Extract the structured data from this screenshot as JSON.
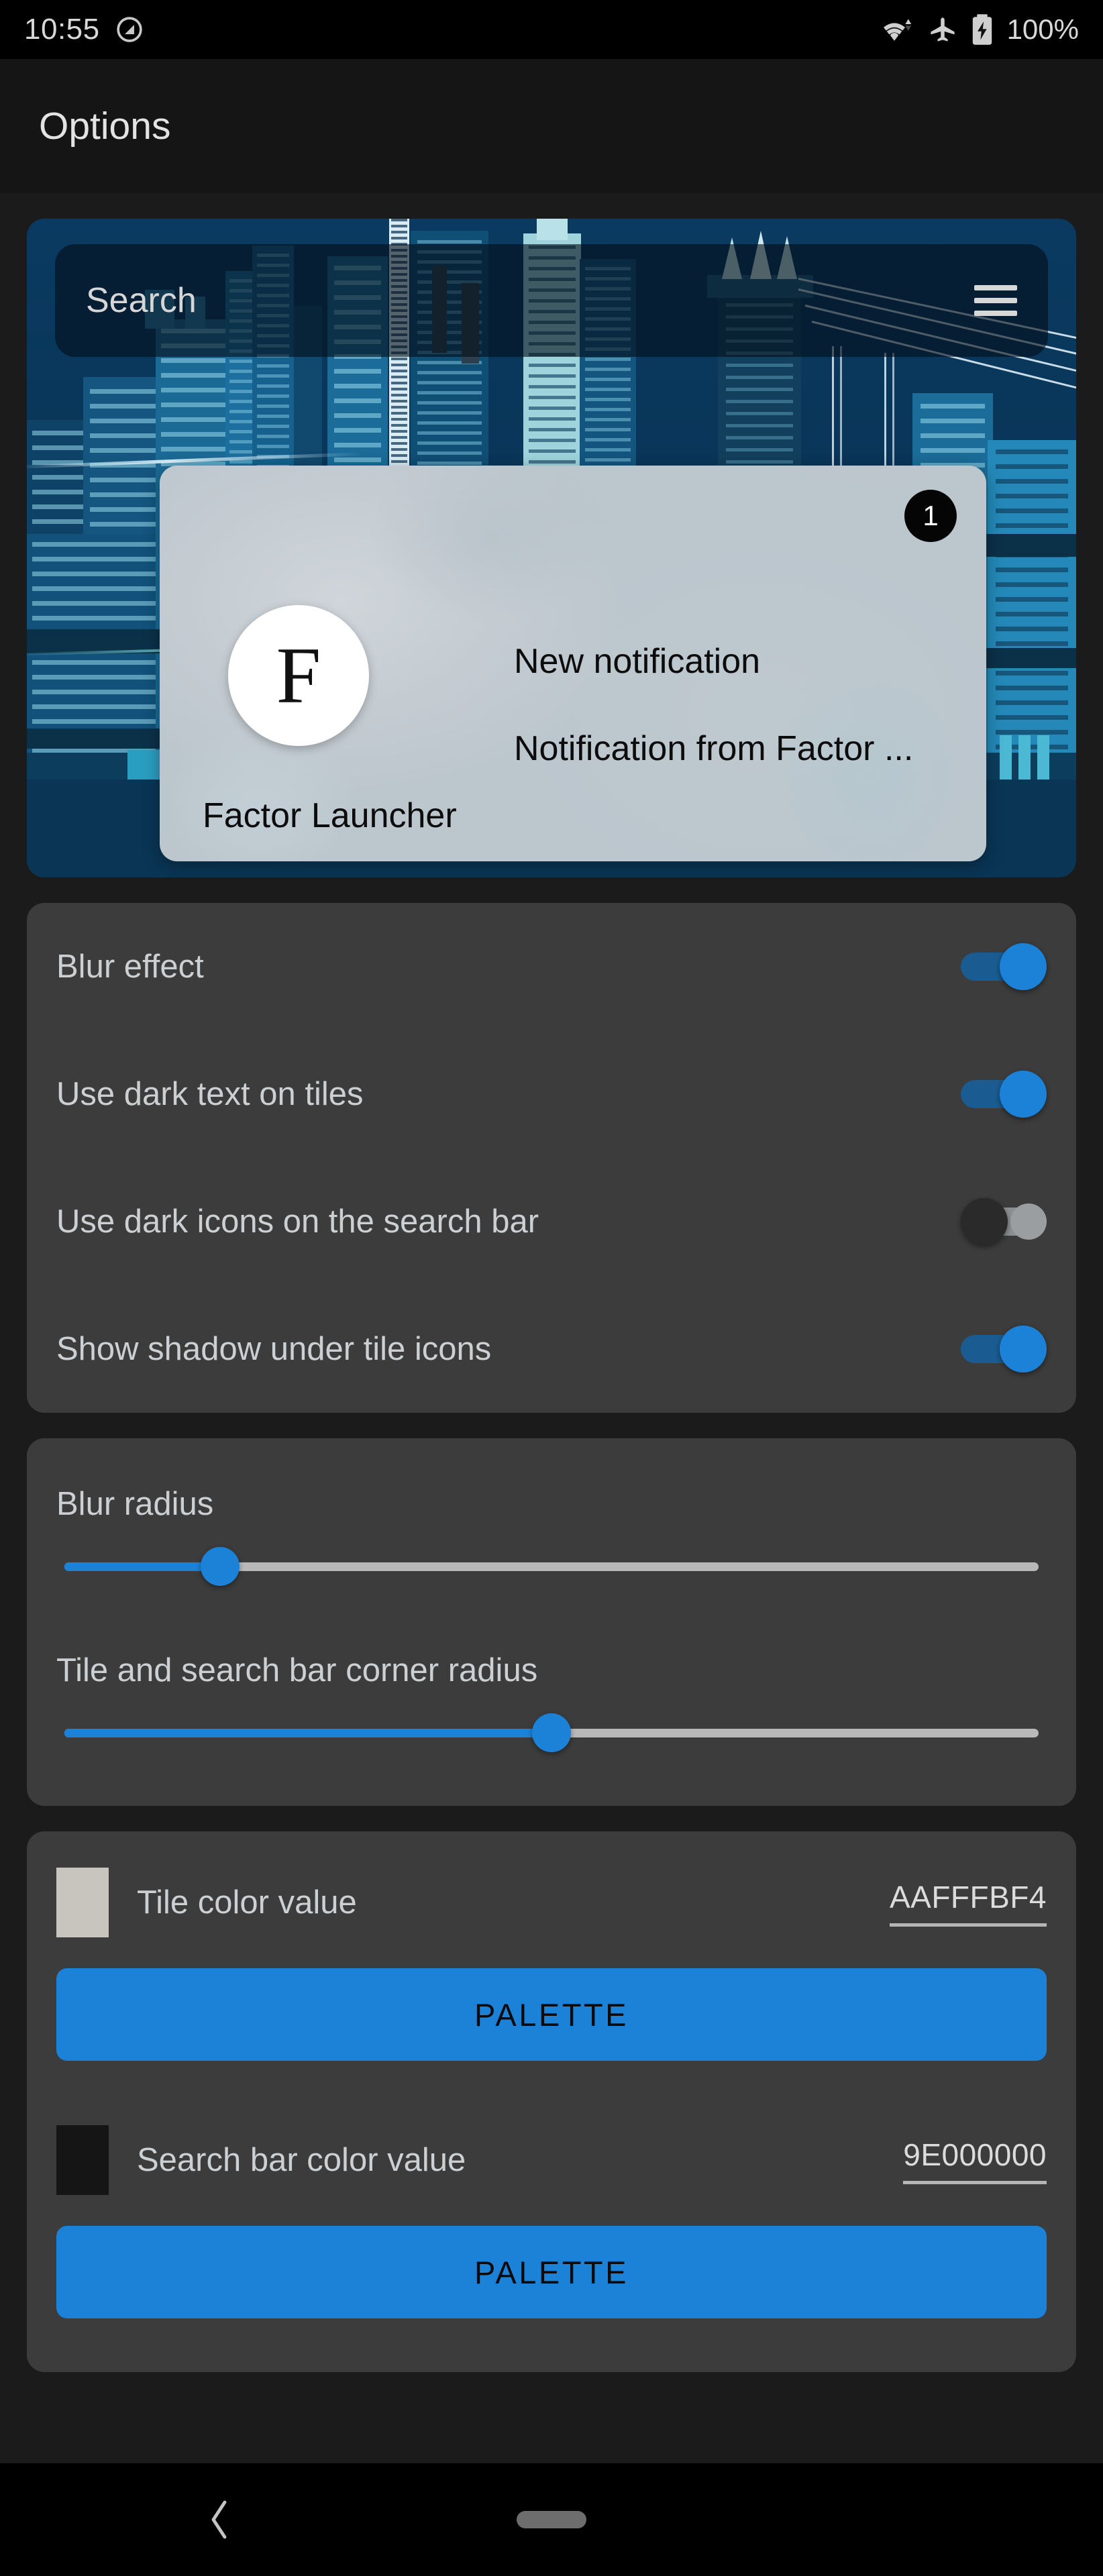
{
  "status_bar": {
    "clock": "10:55",
    "battery_label": "100%",
    "icons": [
      "dnd-icon",
      "wifi-icon",
      "airplane-mode-icon",
      "battery-charging-icon"
    ]
  },
  "header": {
    "title": "Options"
  },
  "preview": {
    "search": {
      "placeholder": "Search",
      "menu_icon": "hamburger-menu-icon"
    },
    "notification_tile": {
      "badge_count": "1",
      "avatar_letter": "F",
      "title": "New notification",
      "body": "Notification from Factor ...",
      "app_name": "Factor Launcher"
    }
  },
  "toggles": [
    {
      "label": "Blur effect",
      "state": "on"
    },
    {
      "label": "Use dark text on tiles",
      "state": "on"
    },
    {
      "label": "Use dark icons on the search bar",
      "state": "off"
    },
    {
      "label": "Show shadow under tile icons",
      "state": "on"
    }
  ],
  "sliders": [
    {
      "label": "Blur radius",
      "percent": 16
    },
    {
      "label": "Tile and search bar corner radius",
      "percent": 50
    }
  ],
  "colors": [
    {
      "label": "Tile color value",
      "value": "AAFFFBF4",
      "swatch_hex": "#c8c5bf",
      "button_label": "PALETTE"
    },
    {
      "label": "Search bar color value",
      "value": "9E000000",
      "swatch_hex": "#151515",
      "button_label": "PALETTE"
    }
  ],
  "accent_colors": {
    "blue": "#1b82d8",
    "card": "#3c3c3c",
    "background": "#1b1b1b"
  },
  "nav_bar": {
    "back_icon": "chevron-left-icon",
    "home_icon": "home-pill-icon"
  }
}
